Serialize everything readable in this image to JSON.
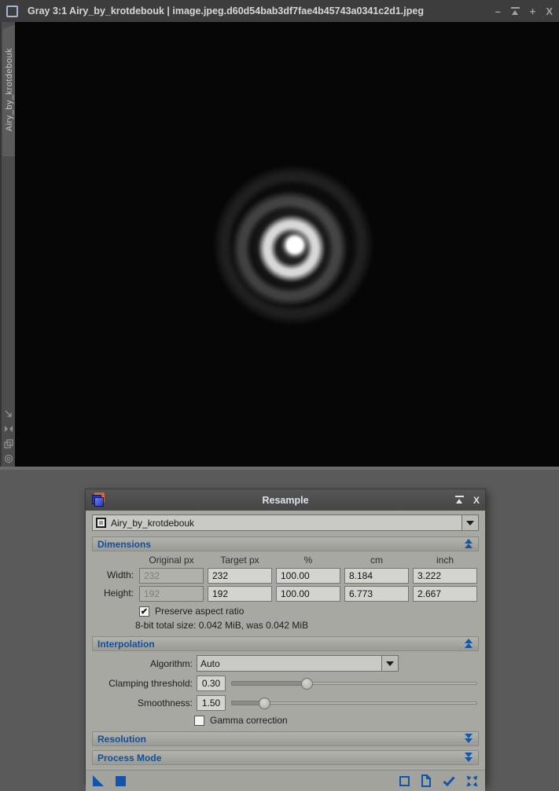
{
  "colors": {
    "accent_blue": "#1155aa",
    "section_text_blue": "#0f4f9e",
    "canvas_black": "#060606"
  },
  "window": {
    "title": "Gray 3:1 Airy_by_krotdebouk | image.jpeg.d60d54bab3df7fae4b45743a0341c2d1.jpeg",
    "tab_label": "Airy_by_krotdebouk",
    "controls": {
      "minimize": "–",
      "maximize": "+",
      "close": "X"
    },
    "strip_icons": [
      "zoom-corner-icon",
      "fit-view-icon",
      "duplicate-view-icon",
      "center-view-icon"
    ]
  },
  "dialog": {
    "title": "Resample",
    "controls": {
      "close": "X"
    },
    "view_selector": {
      "value": "Airy_by_krotdebouk"
    },
    "dimensions": {
      "label": "Dimensions",
      "columns": [
        "Original px",
        "Target px",
        "%",
        "cm",
        "inch"
      ],
      "rows": [
        {
          "label": "Width:",
          "original": "232",
          "target": "232",
          "percent": "100.00",
          "cm": "8.184",
          "inch": "3.222"
        },
        {
          "label": "Height:",
          "original": "192",
          "target": "192",
          "percent": "100.00",
          "cm": "6.773",
          "inch": "2.667"
        }
      ],
      "preserve_aspect": {
        "label": "Preserve aspect ratio",
        "checked": true,
        "check_glyph": "✔"
      },
      "size_text": "8-bit total size: 0.042 MiB, was 0.042 MiB"
    },
    "interpolation": {
      "label": "Interpolation",
      "algorithm": {
        "label": "Algorithm:",
        "value": "Auto"
      },
      "clamping": {
        "label": "Clamping threshold:",
        "value": "0.30",
        "fill_style": "width:31%"
      },
      "smoothness": {
        "label": "Smoothness:",
        "value": "1.50",
        "fill_style": "width:14%"
      },
      "gamma": {
        "label": "Gamma correction",
        "checked": false,
        "check_glyph": ""
      }
    },
    "resolution": {
      "label": "Resolution"
    },
    "process_mode": {
      "label": "Process Mode"
    }
  }
}
